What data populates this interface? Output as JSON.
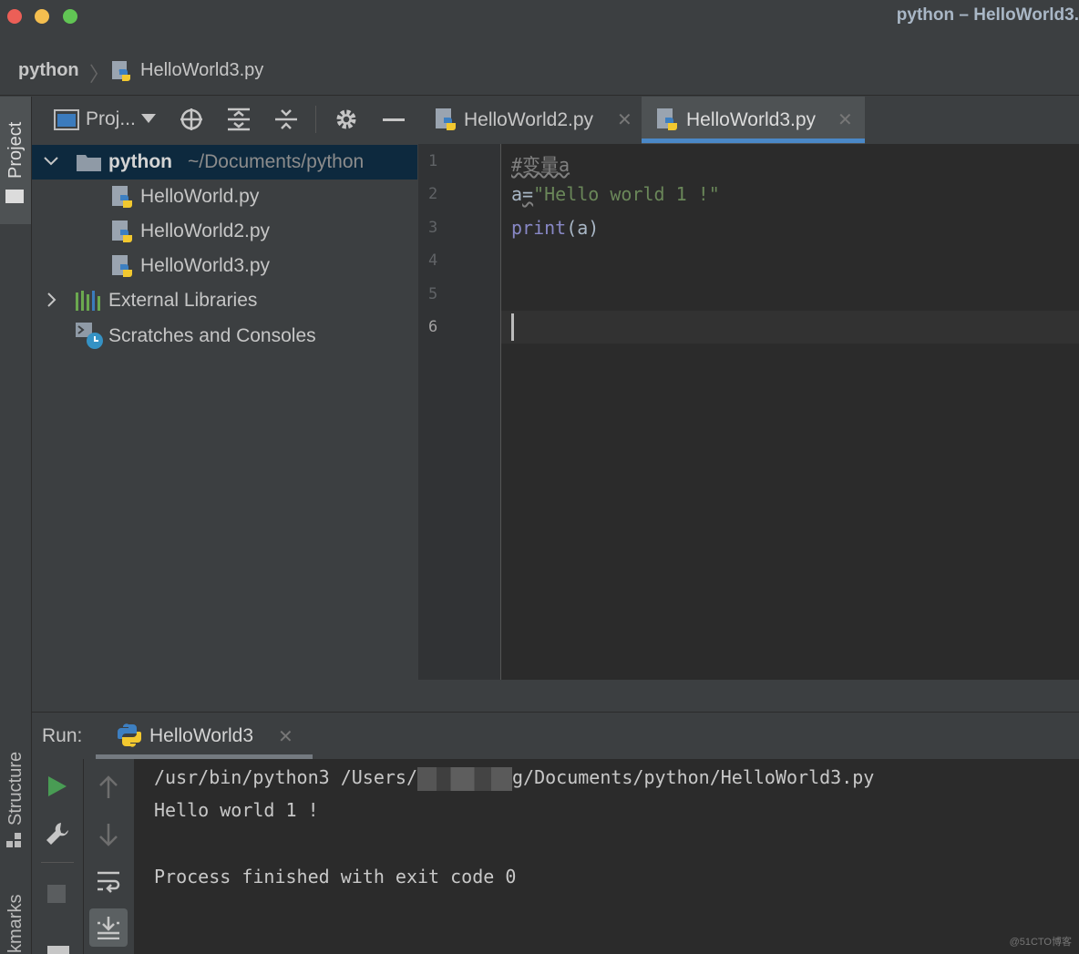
{
  "window": {
    "title": "python – HelloWorld3.",
    "colors": {
      "close": "#ec5f57",
      "minimize": "#f4be4f",
      "zoom": "#61c554"
    }
  },
  "breadcrumb": {
    "project": "python",
    "file": "HelloWorld3.py"
  },
  "left_stripe": {
    "project_label": "Project",
    "structure_label": "Structure",
    "bookmarks_label": "kmarks"
  },
  "project_panel": {
    "view_selector": "Proj...",
    "root": {
      "name": "python",
      "path": "~/Documents/python"
    },
    "files": [
      "HelloWorld.py",
      "HelloWorld2.py",
      "HelloWorld3.py"
    ],
    "external_libraries": "External Libraries",
    "scratches": "Scratches and Consoles"
  },
  "editor": {
    "tabs": [
      {
        "label": "HelloWorld2.py",
        "active": false
      },
      {
        "label": "HelloWorld3.py",
        "active": true
      }
    ],
    "line_numbers": [
      "1",
      "2",
      "3",
      "4",
      "5",
      "6"
    ],
    "code": {
      "line1": "#变量a",
      "line2_var": "a",
      "line2_eq": "=",
      "line2_str": "\"Hello world 1 !\"",
      "line3_func": "print",
      "line3_args": "(a)"
    }
  },
  "run": {
    "label": "Run:",
    "tab": "HelloWorld3",
    "console": {
      "cmd_prefix": "/usr/bin/python3 /Users/",
      "cmd_suffix": "g/Documents/python/HelloWorld3.py",
      "output": "Hello world 1 !",
      "exit": "Process finished with exit code 0"
    }
  },
  "watermark": "@51CTO博客"
}
